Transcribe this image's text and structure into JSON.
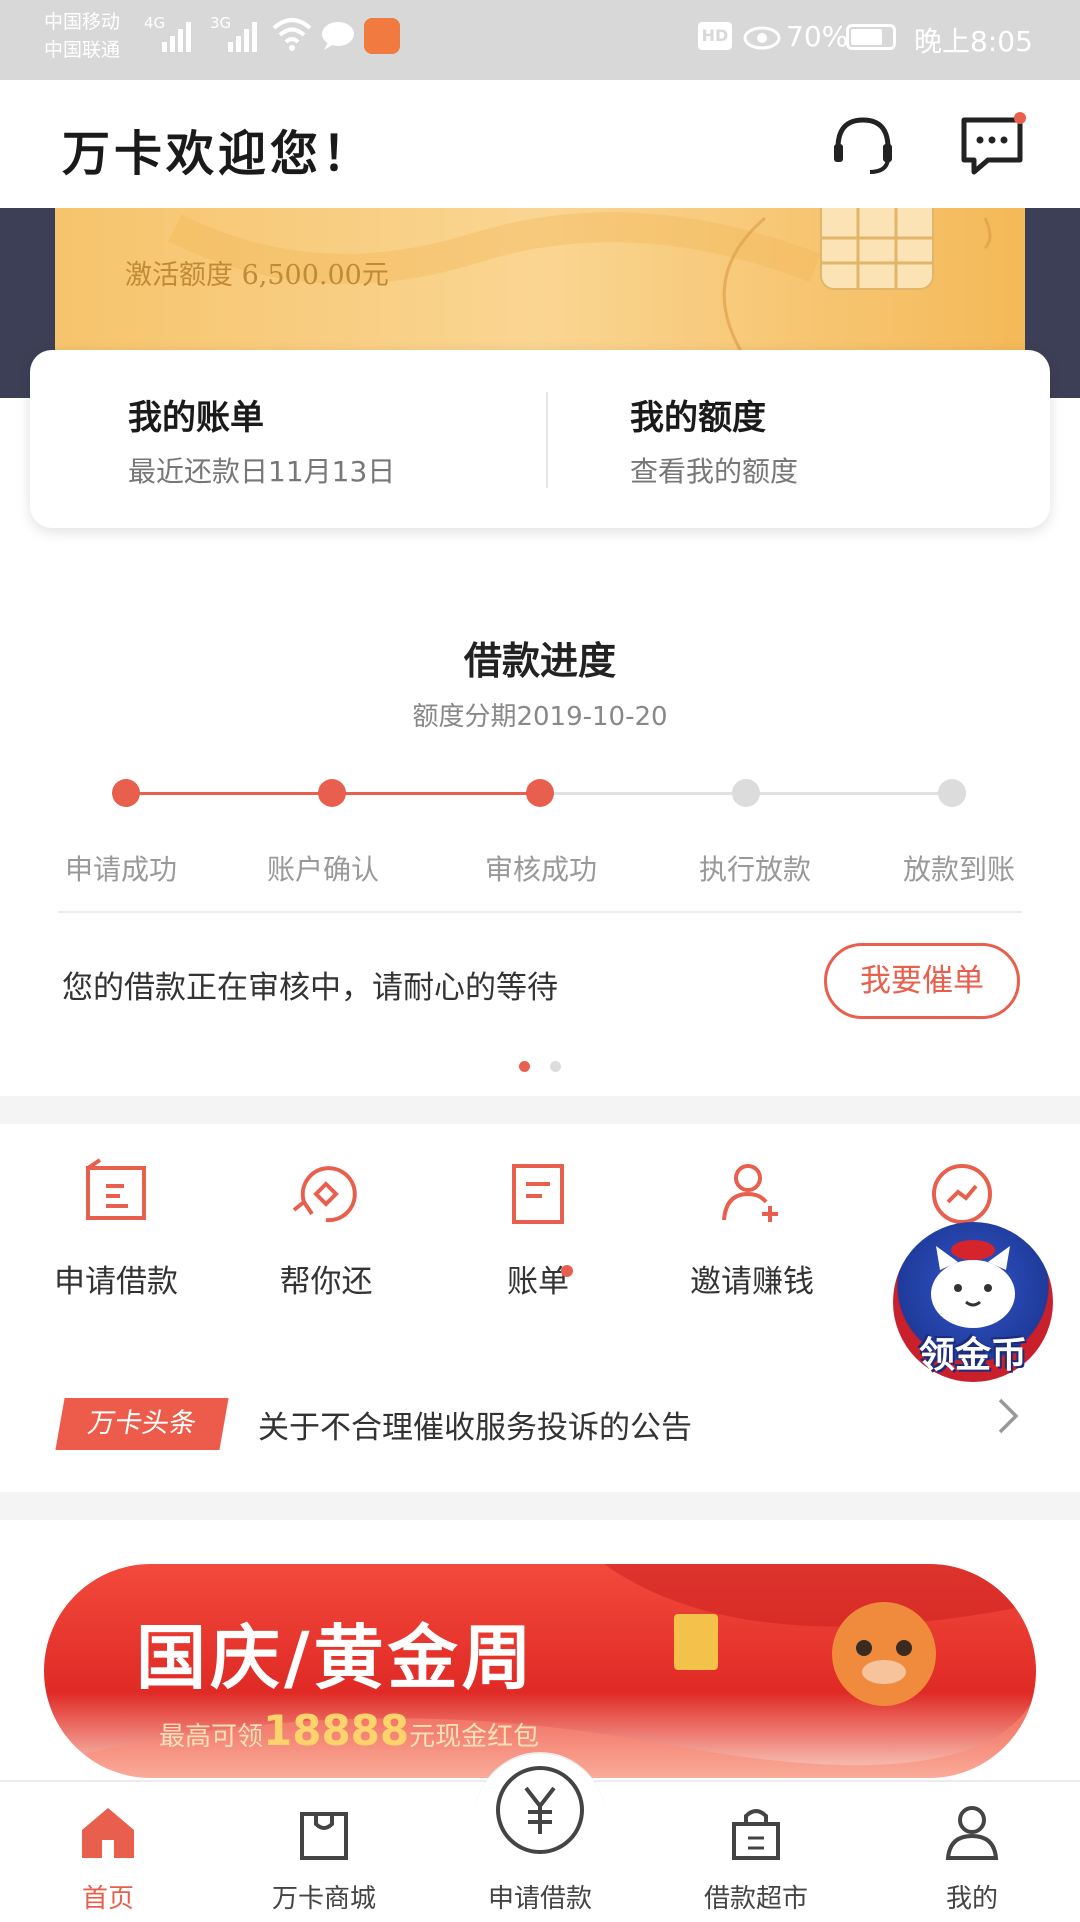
{
  "status_bar": {
    "carrier1": "中国移动",
    "carrier2": "中国联通",
    "net1": "4G",
    "net2": "3G",
    "hd": "HD",
    "battery": "70%",
    "time": "晚上8:05"
  },
  "header": {
    "title": "万卡欢迎您！"
  },
  "card": {
    "credit_text": "激活额度 6,500.00元"
  },
  "summary": {
    "bill_title": "我的账单",
    "bill_sub": "最近还款日11月13日",
    "limit_title": "我的额度",
    "limit_sub": "查看我的额度"
  },
  "progress": {
    "title": "借款进度",
    "subtitle": "额度分期2019-10-20",
    "steps": [
      {
        "label": "申请成功"
      },
      {
        "label": "账户确认"
      },
      {
        "label": "审核成功"
      },
      {
        "label": "执行放款"
      },
      {
        "label": "放款到账"
      }
    ],
    "completed_steps": 3,
    "message": "您的借款正在审核中，请耐心的等待",
    "urge_label": "我要催单"
  },
  "quick_actions": [
    {
      "label": "申请借款",
      "icon": "loan-apply-icon"
    },
    {
      "label": "帮你还",
      "icon": "repay-icon"
    },
    {
      "label": "账单",
      "icon": "bill-icon"
    },
    {
      "label": "邀请赚钱",
      "icon": "invite-icon"
    },
    {
      "label": "",
      "icon": "trend-icon"
    }
  ],
  "coin_badge": {
    "label": "领金币"
  },
  "news": {
    "badge": "万卡头条",
    "text": "关于不合理催收服务投诉的公告"
  },
  "banner": {
    "title": "国庆/黄金周",
    "sub_prefix": "最高可领",
    "amount": "18888",
    "sub_suffix": "元现金红包"
  },
  "bottom_nav": [
    {
      "label": "首页",
      "active": true
    },
    {
      "label": "万卡商城"
    },
    {
      "label": "申请借款"
    },
    {
      "label": "借款超市"
    },
    {
      "label": "我的"
    }
  ],
  "colors": {
    "accent": "#e8604d",
    "inactive_step": "#dcdcdc",
    "card_gold": "#f6c46c",
    "dark_band": "#3c3f56"
  }
}
